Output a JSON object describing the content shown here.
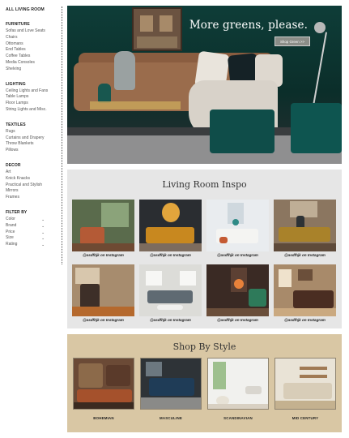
{
  "sidebar": {
    "title": "ALL LIVING ROOM",
    "sections": [
      {
        "heading": "FURNITURE",
        "items": [
          "Sofas and Love Seats",
          "Chairs",
          "Ottomans",
          "End Tables",
          "Coffee Tables",
          "Media Consoles",
          "Shelving"
        ]
      },
      {
        "heading": "LIGHTING",
        "items": [
          "Ceiling Lights and Fans",
          "Table Lamps",
          "Floor Lamps",
          "String Lights and Misc."
        ]
      },
      {
        "heading": "TEXTILES",
        "items": [
          "Rugs",
          "Curtains and Drapery",
          "Throw Blankets",
          "Pillows"
        ]
      },
      {
        "heading": "DECOR",
        "items": [
          "Art",
          "Knick Knacks",
          "Practical and Stylish",
          "Mirrors",
          "Frames"
        ]
      }
    ],
    "filter": {
      "heading": "FILTER BY",
      "items": [
        "Color",
        "Brand",
        "Price",
        "Size",
        "Rating"
      ]
    }
  },
  "hero": {
    "title": "More greens, please.",
    "button_label": "Shop Green >>"
  },
  "inspo": {
    "title": "Living Room Inspo",
    "captions": [
      "@asdfhjk on Instagram",
      "@asdfhjk on Instagram",
      "@asdfhjk on Instagram",
      "@asdfhjk on Instagram",
      "@asdfhjk on Instagram",
      "@asdfhjk on Instagram",
      "@asdfhjk on Instagram",
      "@asdfhjk on Instagram"
    ]
  },
  "shop": {
    "title": "Shop By Style",
    "styles": [
      "BOHEMIAN",
      "MASCULINE",
      "SCANDINAVIAN",
      "MID CENTURY"
    ]
  },
  "colors": {
    "accent_green": "#0e4d48",
    "inspo_bg": "#e6e6e6",
    "shop_bg": "#d9c7a4"
  }
}
